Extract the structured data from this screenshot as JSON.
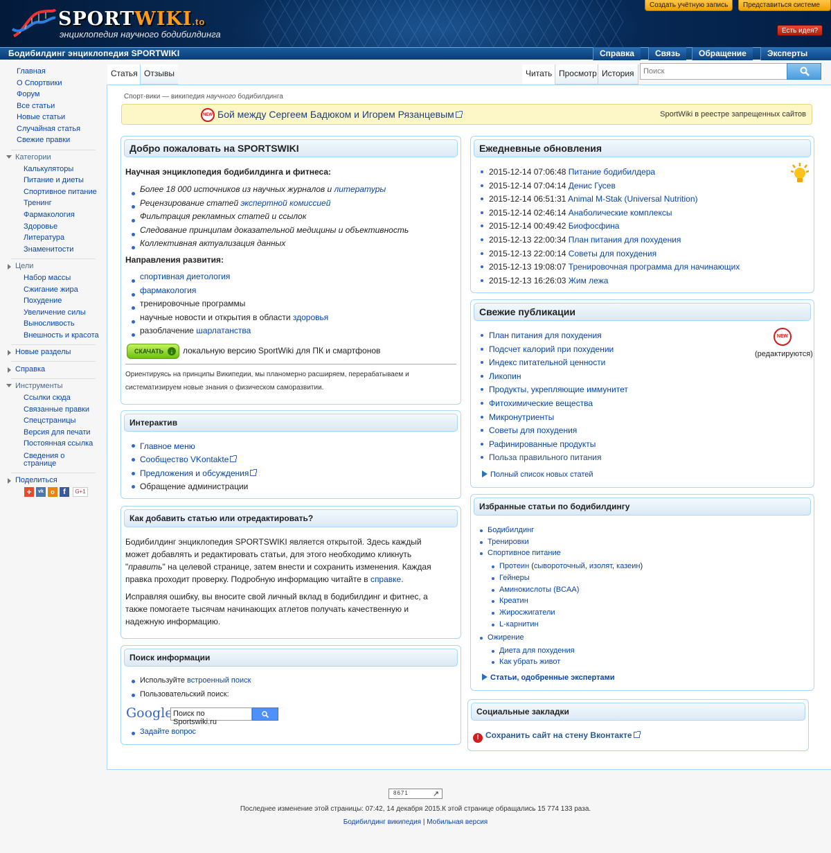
{
  "header": {
    "logo_main": "SPORT",
    "logo_wiki": "WIKI",
    "logo_suffix": ".to",
    "tagline": "энциклопедия научного бодибилдинга",
    "create_account": "Создать учётную запись",
    "login": "Представиться системе",
    "idea": "Есть идея?",
    "colors": {
      "navbar": "#0b3d73",
      "orange": "#f0a100",
      "link": "#0645ad"
    }
  },
  "navbar": {
    "title": "Бодибилдинг энциклопедия SPORTWIKI",
    "items": [
      "Справка",
      "Связь",
      "Обращение",
      "Эксперты"
    ]
  },
  "sidebar": {
    "main": [
      "Главная",
      "О Спортвики",
      "Форум",
      "Все статьи",
      "Новые статьи",
      "Случайная статья",
      "Свежие правки"
    ],
    "categories_title": "Категории",
    "categories": [
      "Калькуляторы",
      "Питание и диеты",
      "Спортивное питание",
      "Тренинг",
      "Фармакология",
      "Здоровье",
      "Литература",
      "Знаменитости"
    ],
    "goals_title": "Цели",
    "goals": [
      "Набор массы",
      "Сжигание жира",
      "Похудение",
      "Увеличение силы",
      "Выносливость",
      "Внешность и красота"
    ],
    "new_sections": "Новые разделы",
    "help": "Справка",
    "tools_title": "Инструменты",
    "tools": [
      "Ссылки сюда",
      "Связанные правки",
      "Спецстраницы",
      "Версия для печати",
      "Постоянная ссылка",
      "Сведения о",
      "странице"
    ],
    "share": "Поделиться",
    "share_icons": [
      "plus-icon",
      "vk-icon",
      "odnoklassniki-icon",
      "facebook-icon",
      "google-plus-icon"
    ],
    "gplus": "G+1"
  },
  "tabs": {
    "article": "Статья",
    "reviews": "Отзывы",
    "read": "Читать",
    "view": "Просмотр",
    "history": "История"
  },
  "search": {
    "placeholder": "Поиск"
  },
  "crumb": {
    "a": "Спорт-вики — википедия ",
    "b": "научного",
    "c": " бодибилдинга"
  },
  "notice": {
    "badge": "NEW",
    "title": "Бой между Сергеем Бадюком и Игорем Рязанцевым",
    "right": "SportWiki в реестре запрещенных сайтов"
  },
  "welcome": {
    "title": "Добро пожаловать на SPORTSWIKI",
    "subtitle": "Научная энциклопедия бодибилдинга и фитнеса:",
    "features": [
      {
        "text": "Более 18 000 источников из научных журналов и ",
        "link": "литературы"
      },
      {
        "text": "Рецензирование статей ",
        "link": "экспертной комиссией"
      },
      {
        "text": "Фильтрация рекламных статей и ссылок",
        "link": ""
      },
      {
        "text": "Следование принципам доказательной медицины и объективность",
        "link": ""
      },
      {
        "text": "Коллективная актуализация данных",
        "link": ""
      }
    ],
    "directions_title": "Направления развития:",
    "directions": [
      {
        "pre": "",
        "link": "спортивная диетология",
        "post": ""
      },
      {
        "pre": "",
        "link": "фармакология",
        "post": ""
      },
      {
        "pre": "",
        "link": "тренировочные программы",
        "post": ""
      },
      {
        "pre": "научные новости и открытия в области ",
        "link": "здоровья",
        "post": ""
      },
      {
        "pre": "разоблачение ",
        "link": "шарлатанства",
        "post": ""
      }
    ],
    "download_btn": "СКАЧАТЬ",
    "download_text": "локальную версию SportWiki для ПК и смартфонов",
    "note_line1": "Ориентируясь на принципы Википедии, мы планомерно расширяем, перерабатываем и",
    "note_line2": "систематизируем новые знания о физическом саморазвитии."
  },
  "interactive": {
    "title": "Интерактив",
    "items": [
      "Главное меню",
      "Сообщество VKontakte",
      "Предложения и обсуждения",
      "Обращение администрации"
    ]
  },
  "howto": {
    "title": "Как добавить статью или отредактировать?",
    "p1_l1": "Бодибилдинг энциклопедия SPORTSWIKI является открытой. Здесь каждый",
    "p1_l2": "может добавлять и редактировать статьи, для этого необходимо кликнуть",
    "p1_l3a": "\"",
    "p1_l3b": "править",
    "p1_l3c": "\" на целевой странице, затем внести и сохранить изменения. Каждая",
    "p1_l4a": "правка проходит проверку. Подробную информацию читайте в ",
    "p1_l4b": "справке",
    "p1_l4c": ".",
    "p2_l1": "Исправляя ошибку, вы вносите свой личный вклад в бодибилдинг и фитнес, а",
    "p2_l2": "также помогаете тысячам начинающих атлетов получать качественную и",
    "p2_l3": "надежную информацию."
  },
  "searchinfo": {
    "title": "Поиск информации",
    "item1_pre": "Используйте ",
    "item1_link": "встроенный поиск",
    "item2": "Пользовательский поиск:",
    "google": "Google",
    "google_value": "Поиск по Sportswiki.ru",
    "ask": "Задайте вопрос"
  },
  "daily": {
    "title": "Ежедневные обновления",
    "items": [
      {
        "date": "2015-12-14 07:06:48",
        "link": "Питание бодибилдера"
      },
      {
        "date": "2015-12-14 07:04:14",
        "link": "Денис Гусев"
      },
      {
        "date": "2015-12-14 06:51:31",
        "link": "Animal M-Stak (Universal Nutrition)"
      },
      {
        "date": "2015-12-14 02:46:14",
        "link": "Анаболические комплексы"
      },
      {
        "date": "2015-12-14 00:49:42",
        "link": "Биофосфина"
      },
      {
        "date": "2015-12-13 22:00:34",
        "link": "План питания для похудения"
      },
      {
        "date": "2015-12-13 22:00:14",
        "link": "Советы для похудения"
      },
      {
        "date": "2015-12-13 19:08:07",
        "link": "Тренировочная программа для начинающих"
      },
      {
        "date": "2015-12-13 16:26:03",
        "link": "Жим лежа"
      }
    ]
  },
  "fresh": {
    "title": "Свежие публикации",
    "items": [
      "План питания для похудения",
      "Подсчет калорий при похудении",
      "Индекс питательной ценности",
      "Ликопин",
      "Продукты, укрепляющие иммунитет",
      "Фитохимические вещества",
      "Микронутриенты",
      "Советы для похудения",
      "Рафинированные продукты",
      "Польза правильного питания"
    ],
    "editing": "(редактируются)",
    "badge": "NEW",
    "full_list": "Полный список новых статей"
  },
  "featured": {
    "title": "Избранные статьи по бодибилдингу",
    "l1": [
      "Бодибилдинг",
      "Тренировки",
      "Спортивное питание"
    ],
    "protein_a": "Протеин",
    "protein_b": " (",
    "protein_c": "сывороточный",
    "protein_d": ", ",
    "protein_e": "изолят",
    "protein_f": ", ",
    "protein_g": "казеин",
    "protein_h": ")",
    "l2": [
      "Гейнеры",
      "Аминокислоты (BCAA)",
      "Креатин",
      "Жиросжигатели",
      "L-карнитин"
    ],
    "weight": "Ожирение",
    "l3": [
      "Диета для похудения",
      "Как убрать живот"
    ],
    "approved": "Статьи, одобренные экспертами"
  },
  "social": {
    "title": "Социальные закладки",
    "item": "Сохранить сайт на стену Вконтакте"
  },
  "footer": {
    "counter": "8671",
    "modified": "Последнее изменение этой страницы: 07:42, 14 декабря 2015.К этой странице обращались 15 774 133 раза.",
    "link1": "Бодибилдинг википедия",
    "sep": " | ",
    "link2": "Мобильная версия"
  }
}
